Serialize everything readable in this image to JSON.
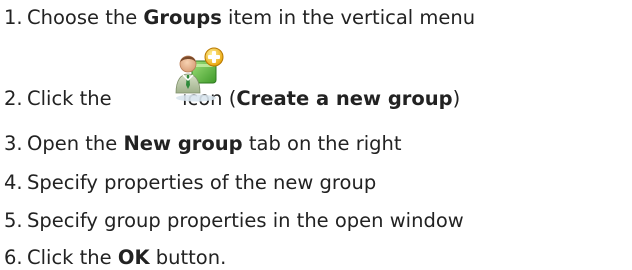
{
  "steps": [
    {
      "number": "1.",
      "before": "Choose the ",
      "bold": "Groups",
      "after": " item in the vertical menu"
    },
    {
      "number": "2.",
      "before": "Click the ",
      "icon": "create-group-icon",
      "between": " icon (",
      "bold": "Create a new group",
      "after": ")"
    },
    {
      "number": "3.",
      "before": "Open the ",
      "bold": "New group",
      "after": " tab on the right"
    },
    {
      "number": "4.",
      "text": "Specify properties of the new group"
    },
    {
      "number": "5.",
      "text": "Specify group properties in the open window"
    },
    {
      "number": "6.",
      "before": "Click the ",
      "bold": "OK",
      "after": " button."
    }
  ]
}
